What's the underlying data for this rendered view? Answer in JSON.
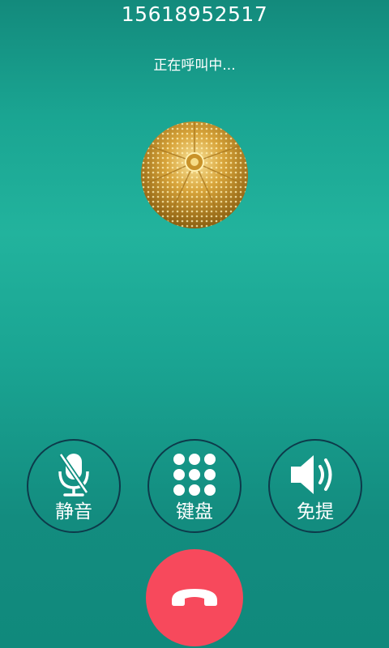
{
  "call": {
    "phone_number": "15618952517",
    "status_text": "正在呼叫中..."
  },
  "controls": {
    "mute_label": "静音",
    "keypad_label": "键盘",
    "speaker_label": "免提"
  },
  "icons": {
    "mute": "microphone-off-icon",
    "keypad": "dialpad-icon",
    "speaker": "speaker-icon",
    "hangup": "phone-hangup-icon"
  },
  "colors": {
    "background_teal": "#1aa592",
    "hangup_red": "#f7495c",
    "ring_border": "#0d3a4a"
  }
}
